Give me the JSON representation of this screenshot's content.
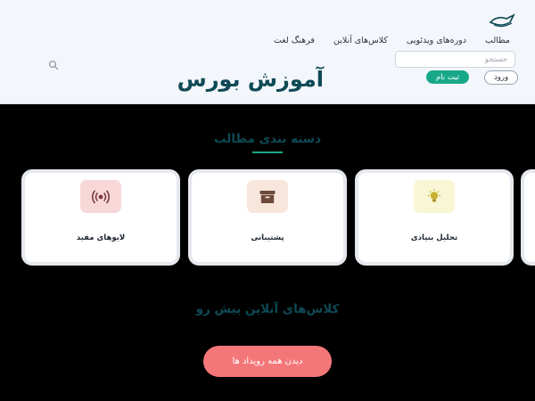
{
  "nav": {
    "items": [
      {
        "label": "مطالب"
      },
      {
        "label": "دوره‌های ویدئویی"
      },
      {
        "label": "کلاس‌های آنلاین"
      },
      {
        "label": "فرهنگ لغت"
      }
    ]
  },
  "header": {
    "search_placeholder": "جستجو",
    "login_label": "ورود",
    "signup_label": "ثبت نام",
    "title": "آموزش بورس"
  },
  "categories": {
    "title": "دسته بندی مطالب",
    "items": [
      {
        "label": "تحلیل بنیادی",
        "icon": "lightbulb-icon"
      },
      {
        "label": "پشتیبانی",
        "icon": "archive-box-icon"
      },
      {
        "label": "لایوهای مفید",
        "icon": "broadcast-icon"
      }
    ]
  },
  "events": {
    "title": "کلاس‌های آنلاین پیش رو",
    "button_label": "دیدن همه رویداد ها"
  },
  "colors": {
    "accent": "#17a88a",
    "title": "#0e4a55",
    "events_button": "#f37779",
    "lightbulb_bg": "#f8f6d5",
    "archive_bg": "#f8e6dc",
    "broadcast_bg": "#f8d7d9"
  }
}
